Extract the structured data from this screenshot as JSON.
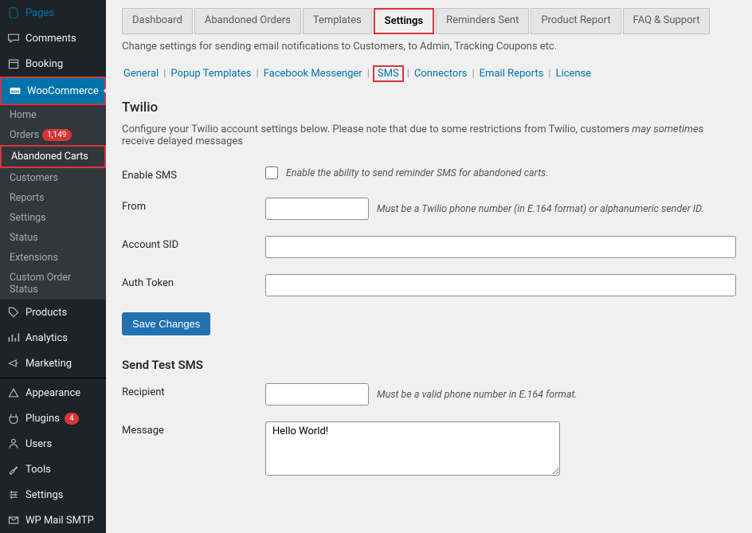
{
  "sidebar": {
    "top": [
      {
        "label": "Pages",
        "icon": "pages"
      },
      {
        "label": "Comments",
        "icon": "comments"
      },
      {
        "label": "Booking",
        "icon": "calendar"
      },
      {
        "label": "WooCommerce",
        "icon": "woo",
        "active": true,
        "highlight": true
      }
    ],
    "sub": [
      {
        "label": "Home"
      },
      {
        "label": "Orders",
        "badge": "1,149"
      },
      {
        "label": "Abandoned Carts",
        "highlight": true
      },
      {
        "label": "Customers"
      },
      {
        "label": "Reports"
      },
      {
        "label": "Settings"
      },
      {
        "label": "Status"
      },
      {
        "label": "Extensions"
      },
      {
        "label": "Custom Order Status"
      }
    ],
    "bottom": [
      {
        "label": "Products",
        "icon": "products"
      },
      {
        "label": "Analytics",
        "icon": "analytics"
      },
      {
        "label": "Marketing",
        "icon": "marketing"
      }
    ],
    "bottom2": [
      {
        "label": "Appearance",
        "icon": "appearance"
      },
      {
        "label": "Plugins",
        "icon": "plugins",
        "badge": "4"
      },
      {
        "label": "Users",
        "icon": "users"
      },
      {
        "label": "Tools",
        "icon": "tools"
      },
      {
        "label": "Settings",
        "icon": "settings"
      },
      {
        "label": "WP Mail SMTP",
        "icon": "mail"
      }
    ]
  },
  "tabs": [
    "Dashboard",
    "Abandoned Orders",
    "Templates",
    "Settings",
    "Reminders Sent",
    "Product Report",
    "FAQ & Support"
  ],
  "active_tab": "Settings",
  "help_text": "Change settings for sending email notifications to Customers, to Admin, Tracking Coupons etc.",
  "sublinks": [
    "General",
    "Popup Templates",
    "Facebook Messenger",
    "SMS",
    "Connectors",
    "Email Reports",
    "License"
  ],
  "active_sublink": "SMS",
  "section_title": "Twilio",
  "section_desc_pre": "Configure your Twilio account settings below. Please note that due to some restrictions from Twilio, customers ",
  "section_desc_em": "may sometimes",
  "section_desc_post": " receive delayed messages",
  "rows": {
    "enable": {
      "label": "Enable SMS",
      "hint": "Enable the ability to send reminder SMS for abandoned carts."
    },
    "from": {
      "label": "From",
      "hint": "Must be a Twilio phone number (in E.164 format) or alphanumeric sender ID."
    },
    "sid": {
      "label": "Account SID"
    },
    "token": {
      "label": "Auth Token"
    }
  },
  "save_btn": "Save Changes",
  "test_title": "Send Test SMS",
  "test": {
    "recipient": {
      "label": "Recipient",
      "hint": "Must be a valid phone number in E.164 format."
    },
    "message": {
      "label": "Message",
      "value": "Hello World!"
    }
  }
}
